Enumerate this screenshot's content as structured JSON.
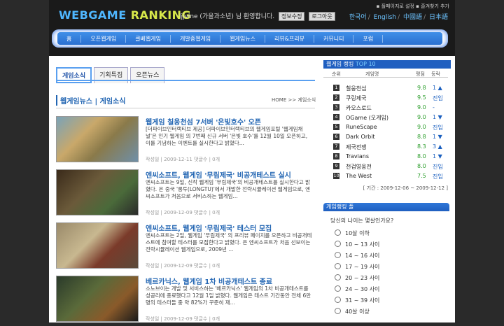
{
  "header": {
    "logo_main": "WEBGAME",
    "logo_sub": "RANKING",
    "welcome": "ljjvine (가을과소년) 님 환영합니다.",
    "mypage_btn": "정보수정",
    "logout_btn": "로그아웃",
    "top_links": "▪ 플페이지로 설정  ▪ 즐겨찾기 추가",
    "langs": [
      "한국어",
      "English",
      "中國語",
      "日本語"
    ]
  },
  "nav": {
    "items": [
      "홈",
      "오픈웹게임",
      "클베웹게임",
      "개발중웹게임",
      "웹게임뉴스",
      "리뷰&프리뷰",
      "커뮤니티",
      "포럼"
    ]
  },
  "main": {
    "tabs": [
      "게임소식",
      "기획특집",
      "오픈뉴스"
    ],
    "section_title": "웹게임뉴스 | 게임소식",
    "breadcrumb": "HOME >> 게임소식",
    "articles": [
      {
        "title": "웹게임 칠웅천섬 7서버 '은빛호수' 오픈",
        "body": "[더파이브인터랙티브 제공] 더파이브인터랙티브의 웹게임포털 '웹게임채널'은 인기 웹게임 의 7번째 신규 서버 '은빛 호수'를 12월 10일 오픈하고, 이를 기념하는 이벤트를 실시한다고 밝혔다...",
        "meta": "작성일 | 2009-12-11    댓글수 | 0개"
      },
      {
        "title": "엔씨소프트, 웹게임 '무림제국' 비공개테스트 실시",
        "body": "엔씨소프트는 9일, 신작 웹게임 '무림제국'의 비공개테스트를 실시한다고 밝혔다. 은 중국 '롱투(LONGTU)'에서 개발한 전략시뮬레이션 웹게임으로, 엔씨소프트가 처음으로 서비스하는 웹게임...",
        "meta": "작성일 | 2009-12-09    댓글수 | 0개"
      },
      {
        "title": "엔씨소프트, 웹게임 '무림제국' 테스터 모집",
        "body": "엔씨소프트는 2일, 웹게임 '무림제국' 의 프리뷰 페이지를 오픈하고 비공개테스트에 참여할 테스터를 모집한다고 밝혔다. 은 엔씨소프트가 처음 선보이는 전략시뮬레이션 웹게임으로, 2009년 ...",
        "meta": "작성일 | 2009-12-09    댓글수 | 0개"
      },
      {
        "title": "베르카닉스, 웹게임 1차 비공개테스트 종료",
        "body": "소노브이는 개발 및 서비스하는 '베르카닉스' 웹게임의 1차 비공개테스트를 성공리에 종료했다고 12월 1일 밝혔다. 웹게임은 테스트 기간동안 전체 6만명의 테스터들 중 약 82%가 꾸준히 재...",
        "meta": "작성일 | 2009-12-09    댓글수 | 0개"
      }
    ]
  },
  "sidebar": {
    "ranking_title": "웹게임 랭킹",
    "ranking_sub": "TOP 10",
    "col_rank": "순위",
    "col_name": "게임명",
    "col_score": "평점",
    "col_change": "등락",
    "rankings": [
      {
        "rank": "1",
        "name": "칠웅천섬",
        "score": "9.8",
        "change": "1 ▲"
      },
      {
        "rank": "2",
        "name": "쿠링제국",
        "score": "9.5",
        "change": "진입"
      },
      {
        "rank": "3",
        "name": "카오스로드",
        "score": "9.0",
        "change": "-"
      },
      {
        "rank": "4",
        "name": "OGame (오게임)",
        "score": "9.0",
        "change": "1 ▼"
      },
      {
        "rank": "5",
        "name": "RuneScape",
        "score": "9.0",
        "change": "진입"
      },
      {
        "rank": "6",
        "name": "Dark Orbit",
        "score": "8.8",
        "change": "1 ▼"
      },
      {
        "rank": "7",
        "name": "제국전쟁",
        "score": "8.3",
        "change": "3 ▲"
      },
      {
        "rank": "8",
        "name": "Travians",
        "score": "8.0",
        "change": "1 ▼"
      },
      {
        "rank": "9",
        "name": "천검영웅전",
        "score": "8.0",
        "change": "진입"
      },
      {
        "rank": "10",
        "name": "The West",
        "score": "7.5",
        "change": "진입"
      }
    ],
    "period": "[ 기간 : 2009-12-06 ~ 2009-12-12 ]",
    "poll_title": "게임랭킹 폴",
    "poll_question": "당신의 나이는 몇살인가요?",
    "poll_options": [
      "10살 이하",
      "10 ~ 13 사이",
      "14 ~ 16 사이",
      "17 ~ 19 사이",
      "20 ~ 23 사이",
      "24 ~ 30 사이",
      "31 ~ 39 사이",
      "40살 이상"
    ],
    "colors": {
      "accent": "#2366b3",
      "header_bg": "#1f5fc0",
      "score": "#2a9d2a"
    }
  }
}
